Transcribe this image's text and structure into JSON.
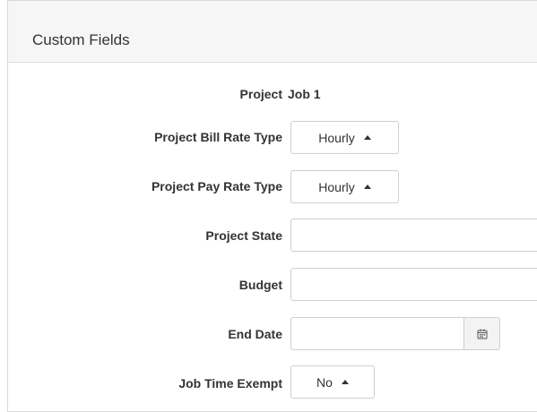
{
  "panel": {
    "title": "Custom Fields"
  },
  "fields": {
    "project": {
      "label": "Project",
      "value": "Job 1"
    },
    "bill_rate_type": {
      "label": "Project Bill Rate Type",
      "value": "Hourly"
    },
    "pay_rate_type": {
      "label": "Project Pay Rate Type",
      "value": "Hourly"
    },
    "project_state": {
      "label": "Project State",
      "value": ""
    },
    "budget": {
      "label": "Budget",
      "value": ""
    },
    "end_date": {
      "label": "End Date",
      "value": "",
      "icon": "calendar-icon"
    },
    "job_time_exempt": {
      "label": "Job Time Exempt",
      "value": "No"
    }
  },
  "icons": {
    "dropdown_caret": "caret-up-icon",
    "calendar": "calendar-icon"
  }
}
